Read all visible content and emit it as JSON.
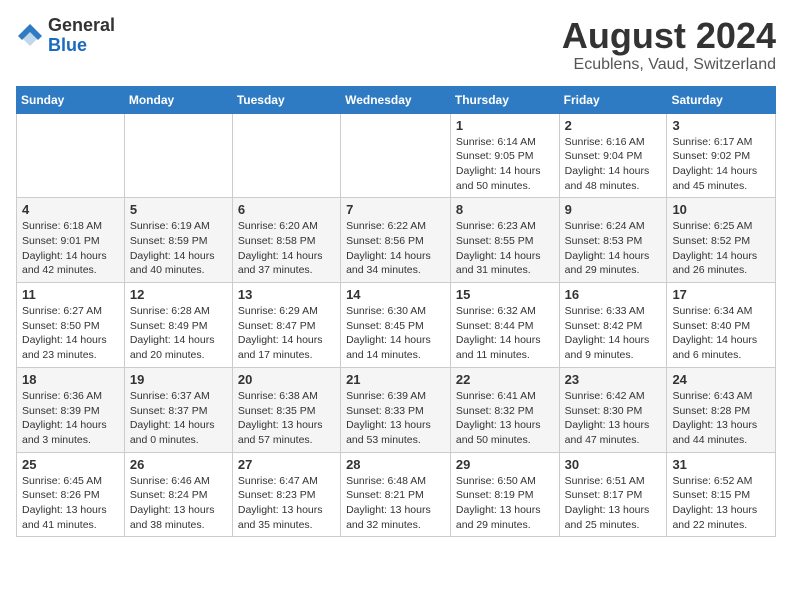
{
  "header": {
    "logo_general": "General",
    "logo_blue": "Blue",
    "title": "August 2024",
    "subtitle": "Ecublens, Vaud, Switzerland"
  },
  "days_of_week": [
    "Sunday",
    "Monday",
    "Tuesday",
    "Wednesday",
    "Thursday",
    "Friday",
    "Saturday"
  ],
  "weeks": [
    [
      {
        "num": "",
        "info": ""
      },
      {
        "num": "",
        "info": ""
      },
      {
        "num": "",
        "info": ""
      },
      {
        "num": "",
        "info": ""
      },
      {
        "num": "1",
        "info": "Sunrise: 6:14 AM\nSunset: 9:05 PM\nDaylight: 14 hours and 50 minutes."
      },
      {
        "num": "2",
        "info": "Sunrise: 6:16 AM\nSunset: 9:04 PM\nDaylight: 14 hours and 48 minutes."
      },
      {
        "num": "3",
        "info": "Sunrise: 6:17 AM\nSunset: 9:02 PM\nDaylight: 14 hours and 45 minutes."
      }
    ],
    [
      {
        "num": "4",
        "info": "Sunrise: 6:18 AM\nSunset: 9:01 PM\nDaylight: 14 hours and 42 minutes."
      },
      {
        "num": "5",
        "info": "Sunrise: 6:19 AM\nSunset: 8:59 PM\nDaylight: 14 hours and 40 minutes."
      },
      {
        "num": "6",
        "info": "Sunrise: 6:20 AM\nSunset: 8:58 PM\nDaylight: 14 hours and 37 minutes."
      },
      {
        "num": "7",
        "info": "Sunrise: 6:22 AM\nSunset: 8:56 PM\nDaylight: 14 hours and 34 minutes."
      },
      {
        "num": "8",
        "info": "Sunrise: 6:23 AM\nSunset: 8:55 PM\nDaylight: 14 hours and 31 minutes."
      },
      {
        "num": "9",
        "info": "Sunrise: 6:24 AM\nSunset: 8:53 PM\nDaylight: 14 hours and 29 minutes."
      },
      {
        "num": "10",
        "info": "Sunrise: 6:25 AM\nSunset: 8:52 PM\nDaylight: 14 hours and 26 minutes."
      }
    ],
    [
      {
        "num": "11",
        "info": "Sunrise: 6:27 AM\nSunset: 8:50 PM\nDaylight: 14 hours and 23 minutes."
      },
      {
        "num": "12",
        "info": "Sunrise: 6:28 AM\nSunset: 8:49 PM\nDaylight: 14 hours and 20 minutes."
      },
      {
        "num": "13",
        "info": "Sunrise: 6:29 AM\nSunset: 8:47 PM\nDaylight: 14 hours and 17 minutes."
      },
      {
        "num": "14",
        "info": "Sunrise: 6:30 AM\nSunset: 8:45 PM\nDaylight: 14 hours and 14 minutes."
      },
      {
        "num": "15",
        "info": "Sunrise: 6:32 AM\nSunset: 8:44 PM\nDaylight: 14 hours and 11 minutes."
      },
      {
        "num": "16",
        "info": "Sunrise: 6:33 AM\nSunset: 8:42 PM\nDaylight: 14 hours and 9 minutes."
      },
      {
        "num": "17",
        "info": "Sunrise: 6:34 AM\nSunset: 8:40 PM\nDaylight: 14 hours and 6 minutes."
      }
    ],
    [
      {
        "num": "18",
        "info": "Sunrise: 6:36 AM\nSunset: 8:39 PM\nDaylight: 14 hours and 3 minutes."
      },
      {
        "num": "19",
        "info": "Sunrise: 6:37 AM\nSunset: 8:37 PM\nDaylight: 14 hours and 0 minutes."
      },
      {
        "num": "20",
        "info": "Sunrise: 6:38 AM\nSunset: 8:35 PM\nDaylight: 13 hours and 57 minutes."
      },
      {
        "num": "21",
        "info": "Sunrise: 6:39 AM\nSunset: 8:33 PM\nDaylight: 13 hours and 53 minutes."
      },
      {
        "num": "22",
        "info": "Sunrise: 6:41 AM\nSunset: 8:32 PM\nDaylight: 13 hours and 50 minutes."
      },
      {
        "num": "23",
        "info": "Sunrise: 6:42 AM\nSunset: 8:30 PM\nDaylight: 13 hours and 47 minutes."
      },
      {
        "num": "24",
        "info": "Sunrise: 6:43 AM\nSunset: 8:28 PM\nDaylight: 13 hours and 44 minutes."
      }
    ],
    [
      {
        "num": "25",
        "info": "Sunrise: 6:45 AM\nSunset: 8:26 PM\nDaylight: 13 hours and 41 minutes."
      },
      {
        "num": "26",
        "info": "Sunrise: 6:46 AM\nSunset: 8:24 PM\nDaylight: 13 hours and 38 minutes."
      },
      {
        "num": "27",
        "info": "Sunrise: 6:47 AM\nSunset: 8:23 PM\nDaylight: 13 hours and 35 minutes."
      },
      {
        "num": "28",
        "info": "Sunrise: 6:48 AM\nSunset: 8:21 PM\nDaylight: 13 hours and 32 minutes."
      },
      {
        "num": "29",
        "info": "Sunrise: 6:50 AM\nSunset: 8:19 PM\nDaylight: 13 hours and 29 minutes."
      },
      {
        "num": "30",
        "info": "Sunrise: 6:51 AM\nSunset: 8:17 PM\nDaylight: 13 hours and 25 minutes."
      },
      {
        "num": "31",
        "info": "Sunrise: 6:52 AM\nSunset: 8:15 PM\nDaylight: 13 hours and 22 minutes."
      }
    ]
  ]
}
